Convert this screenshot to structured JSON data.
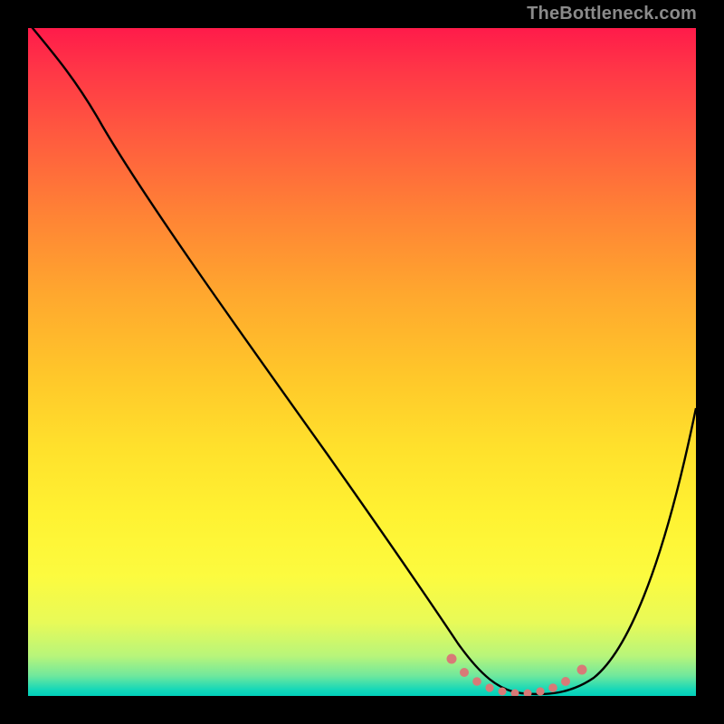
{
  "watermark": "TheBottleneck.com",
  "chart_data": {
    "type": "line",
    "title": "",
    "xlabel": "",
    "ylabel": "",
    "xlim": [
      0,
      100
    ],
    "ylim": [
      0,
      100
    ],
    "grid": false,
    "series": [
      {
        "name": "bottleneck-curve",
        "color": "#000000",
        "x": [
          0,
          3,
          8,
          14,
          20,
          28,
          36,
          44,
          52,
          58,
          62,
          65,
          68,
          71,
          73,
          76,
          78,
          80,
          83,
          86,
          90,
          95,
          100
        ],
        "y": [
          100,
          97,
          92,
          85,
          77,
          67,
          56,
          45,
          34,
          24,
          16,
          10,
          5,
          2,
          0.5,
          0,
          0,
          0.5,
          2,
          6,
          14,
          27,
          44
        ]
      },
      {
        "name": "optimal-zone-markers",
        "type": "scatter",
        "color": "#d87a77",
        "x": [
          63,
          65,
          67,
          69,
          71,
          73,
          75,
          77,
          79,
          81,
          83
        ],
        "y": [
          4,
          2.5,
          1.5,
          0.8,
          0.3,
          0.1,
          0.1,
          0.3,
          0.8,
          1.8,
          3.5
        ]
      }
    ],
    "background_gradient": {
      "top": "#ff1b4a",
      "bottom": "#00cfba"
    }
  }
}
